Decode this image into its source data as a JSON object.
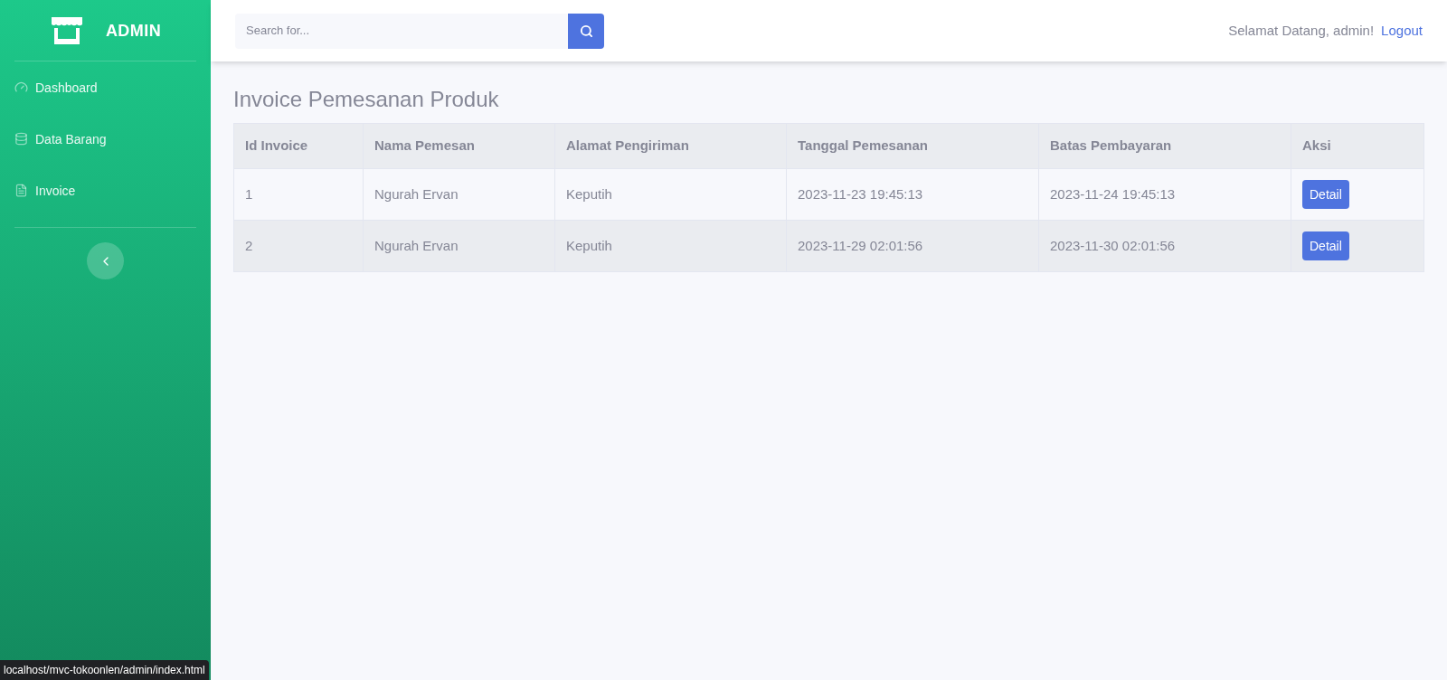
{
  "sidebar": {
    "brand": "ADMIN",
    "items": [
      {
        "label": "Dashboard",
        "kind": "dashboard"
      },
      {
        "label": "Data Barang",
        "kind": "database"
      },
      {
        "label": "Invoice",
        "kind": "file"
      }
    ]
  },
  "topbar": {
    "search": {
      "placeholder": "Search for..."
    },
    "greeting": "Selamat Datang, admin!",
    "logout": "Logout"
  },
  "page": {
    "title": "Invoice Pemesanan Produk"
  },
  "table": {
    "columns": [
      "Id Invoice",
      "Nama Pemesan",
      "Alamat Pengiriman",
      "Tanggal Pemesanan",
      "Batas Pembayaran",
      "Aksi"
    ],
    "rows": [
      {
        "cells": [
          "1",
          "Ngurah Ervan",
          "Keputih",
          "2023-11-23 19:45:13",
          "2023-11-24 19:45:13"
        ],
        "action": "Detail"
      },
      {
        "cells": [
          "2",
          "Ngurah Ervan",
          "Keputih",
          "2023-11-29 02:01:56",
          "2023-11-30 02:01:56"
        ],
        "action": "Detail"
      }
    ]
  },
  "status_bar": {
    "url": "localhost/mvc-tokoonlen/admin/index.html"
  }
}
